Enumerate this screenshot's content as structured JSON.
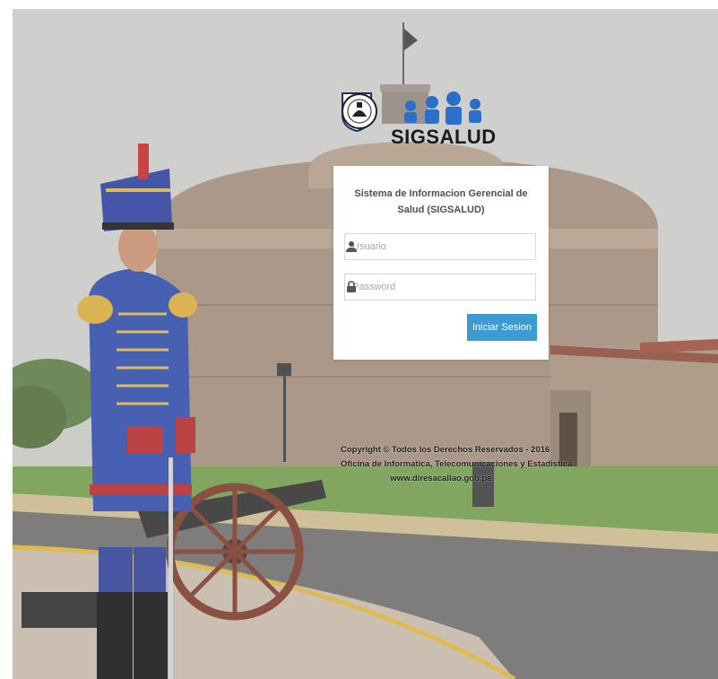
{
  "logos": {
    "brand_name": "SIGSALUD",
    "left_emblem_icon": "region-callao-shield-icon",
    "right_emblem_icon": "institution-seal-icon"
  },
  "login": {
    "title": "Sistema de Informacion Gerencial de Salud (SIGSALUD)",
    "username_placeholder": "Usuario",
    "username_icon": "user-icon",
    "password_placeholder": "Password",
    "password_icon": "lock-icon",
    "submit_label": "Iniciar Sesion"
  },
  "footer": {
    "copyright": "Copyright © Todos los Derechos Reservados - 2016",
    "office": "Oficina de Informatica, Telecomunicaciones y Estadistica",
    "website": "www.diresacallao.gob.pe"
  },
  "colors": {
    "button": "#3c9bd2",
    "brand_blue": "#2a6fc9",
    "card": "#ffffff"
  }
}
